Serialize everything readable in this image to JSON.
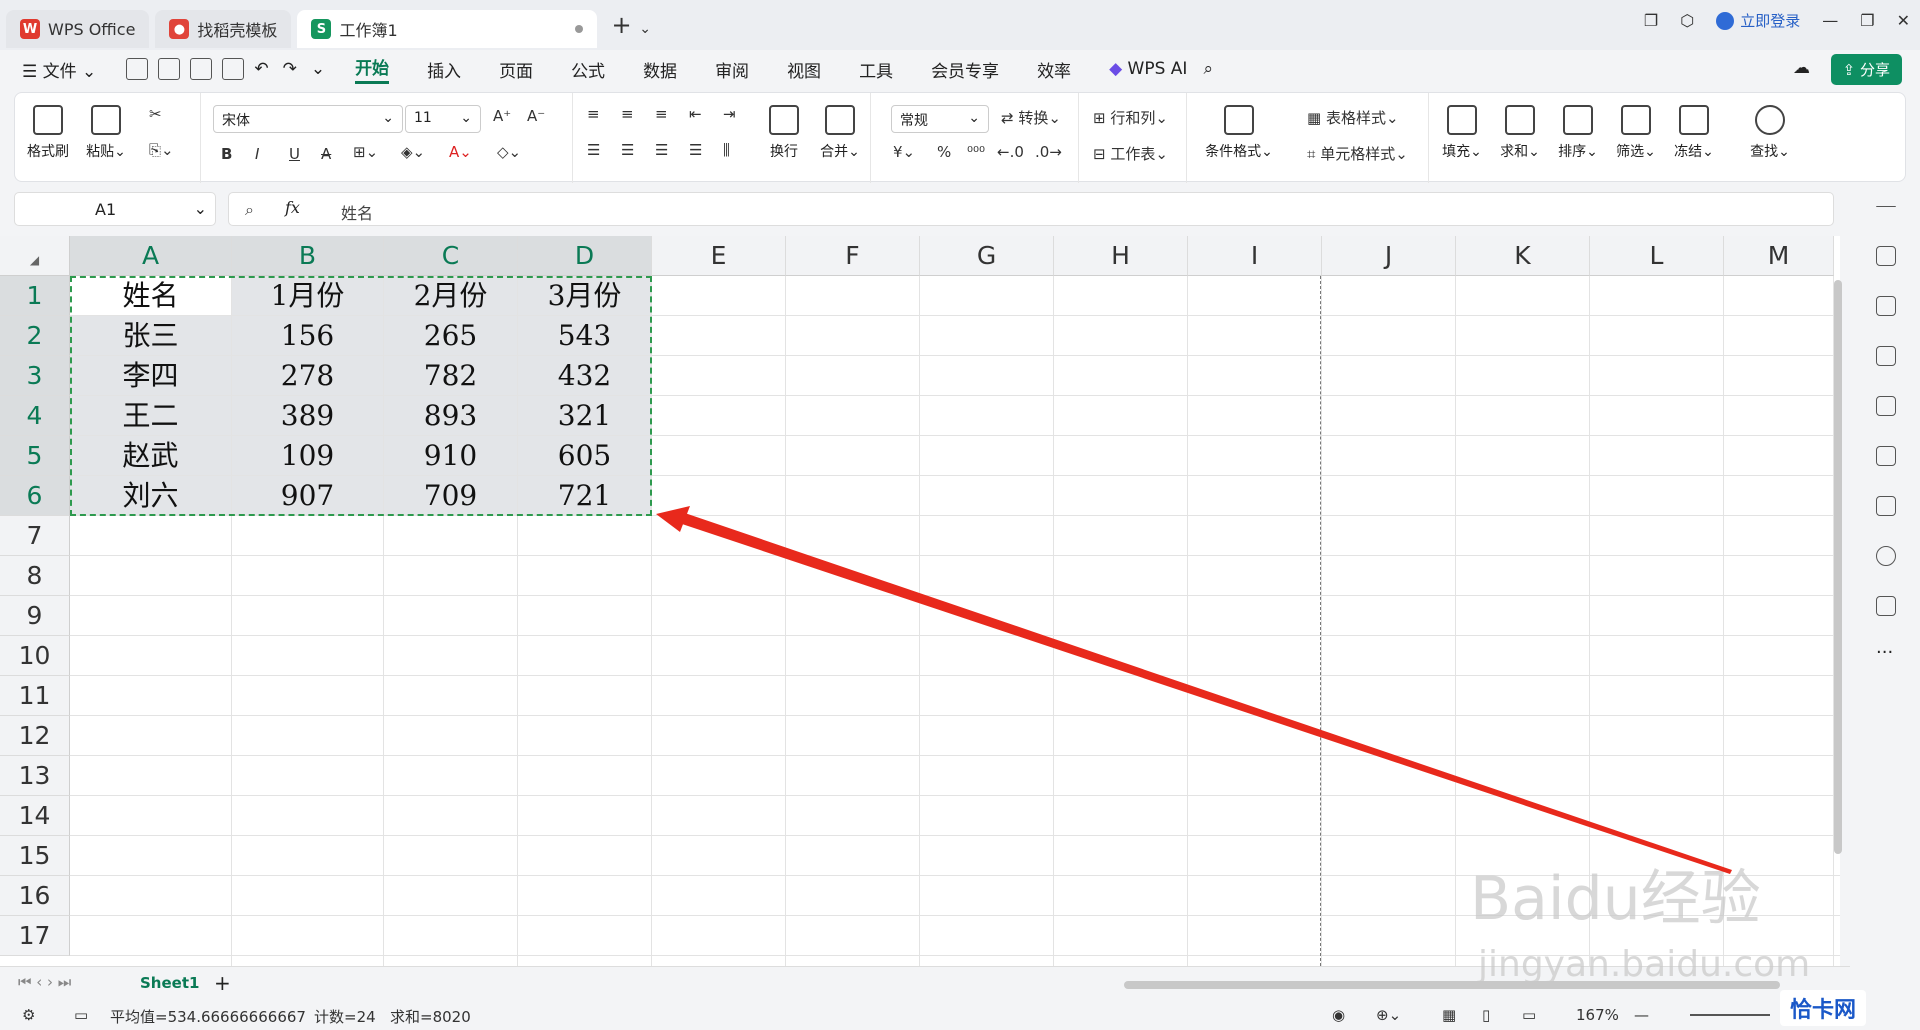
{
  "titlebar": {
    "tabs": [
      {
        "label": "WPS Office"
      },
      {
        "label": "找稻壳模板"
      },
      {
        "label": "工作簿1"
      }
    ],
    "login": "立即登录"
  },
  "menubar": {
    "file": "文件",
    "items": [
      "开始",
      "插入",
      "页面",
      "公式",
      "数据",
      "审阅",
      "视图",
      "工具",
      "会员专享",
      "效率"
    ],
    "wps_ai": "WPS AI",
    "share": "分享"
  },
  "ribbon": {
    "format_painter": "格式刷",
    "paste": "粘贴",
    "font_name": "宋体",
    "font_size": "11",
    "wrap": "换行",
    "merge": "合并",
    "number_format": "常规",
    "convert": "转换",
    "row_col": "行和列",
    "worksheet": "工作表",
    "cond_format": "条件格式",
    "table_style": "表格样式",
    "cell_style": "单元格样式",
    "fill": "填充",
    "sum": "求和",
    "sort": "排序",
    "filter": "筛选",
    "freeze": "冻结",
    "find": "查找"
  },
  "formula": {
    "name_box": "A1",
    "fx": "fx",
    "value": "姓名"
  },
  "columns": [
    "A",
    "B",
    "C",
    "D",
    "E",
    "F",
    "G",
    "H",
    "I",
    "J",
    "K",
    "L",
    "M"
  ],
  "rows": [
    "1",
    "2",
    "3",
    "4",
    "5",
    "6",
    "7",
    "8",
    "9",
    "10",
    "11",
    "12",
    "13",
    "14",
    "15",
    "16",
    "17"
  ],
  "table": [
    [
      "姓名",
      "1月份",
      "2月份",
      "3月份"
    ],
    [
      "张三",
      "156",
      "265",
      "543"
    ],
    [
      "李四",
      "278",
      "782",
      "432"
    ],
    [
      "王二",
      "389",
      "893",
      "321"
    ],
    [
      "赵武",
      "109",
      "910",
      "605"
    ],
    [
      "刘六",
      "907",
      "709",
      "721"
    ]
  ],
  "sheets": {
    "active": "Sheet1",
    "add": "+"
  },
  "status": {
    "avg": "平均值=534.66666666667",
    "count": "计数=24",
    "sum": "求和=8020",
    "zoom": "167%"
  },
  "watermark": {
    "main": "Baidu经验",
    "sub": "jingyan.baidu.com",
    "badge": "恰卡网"
  },
  "colors": {
    "accent": "#0a7a55",
    "arrow": "#e8291c",
    "selection_border": "#2e9a4e"
  }
}
